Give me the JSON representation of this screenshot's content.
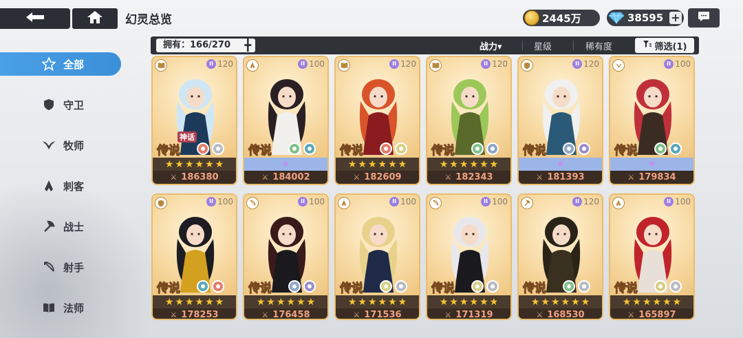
{
  "header": {
    "title": "幻灵总览",
    "gold": "2445万",
    "gems": "38595"
  },
  "sidebar": {
    "items": [
      {
        "label": "全部",
        "icon": "all-star-icon",
        "active": true
      },
      {
        "label": "守卫",
        "icon": "shield-icon",
        "active": false
      },
      {
        "label": "牧师",
        "icon": "wings-icon",
        "active": false
      },
      {
        "label": "刺客",
        "icon": "assassin-icon",
        "active": false
      },
      {
        "label": "战士",
        "icon": "axe-icon",
        "active": false
      },
      {
        "label": "射手",
        "icon": "bow-icon",
        "active": false
      },
      {
        "label": "法师",
        "icon": "book-icon",
        "active": false
      }
    ]
  },
  "filter": {
    "owned": "拥有：166/270",
    "sort_power": "战力▾",
    "sort_stars": "星级",
    "sort_rarity": "稀有度",
    "filter_label": "筛选(1)"
  },
  "cards": [
    {
      "level": "120",
      "rarity": "传说",
      "tag": "神话",
      "power": "186380",
      "class": "book-icon",
      "e1": "fire",
      "e2": "wind",
      "row": "stars",
      "hair": "#cfe6f5",
      "outfit": "#1d3a5a"
    },
    {
      "level": "100",
      "rarity": "传说",
      "tag": "",
      "power": "184002",
      "class": "assassin-icon",
      "e1": "nature",
      "e2": "water",
      "row": "awakening",
      "hair": "#2a2024",
      "outfit": "#f2f0ec"
    },
    {
      "level": "120",
      "rarity": "传说",
      "tag": "",
      "power": "182609",
      "class": "book-icon",
      "e1": "fire",
      "e2": "light",
      "row": "stars",
      "hair": "#d9542a",
      "outfit": "#8a1c20"
    },
    {
      "level": "120",
      "rarity": "传说",
      "tag": "",
      "power": "182343",
      "class": "book-icon",
      "e1": "nature",
      "e2": "star",
      "row": "stars",
      "hair": "#9cc85a",
      "outfit": "#5a6a2a"
    },
    {
      "level": "120",
      "rarity": "传说",
      "tag": "",
      "power": "181393",
      "class": "shield-icon",
      "e1": "star",
      "e2": "void",
      "row": "awakening",
      "hair": "#f0f0f0",
      "outfit": "#2a5a78"
    },
    {
      "level": "100",
      "rarity": "传说",
      "tag": "",
      "power": "179834",
      "class": "wings-icon",
      "e1": "nature",
      "e2": "water",
      "row": "awakening",
      "hair": "#c0303a",
      "outfit": "#3a2c22"
    },
    {
      "level": "100",
      "rarity": "传说",
      "tag": "",
      "power": "178253",
      "class": "shield-icon",
      "e1": "water",
      "e2": "fire",
      "row": "stars",
      "hair": "#1c1c22",
      "outfit": "#d4a020"
    },
    {
      "level": "100",
      "rarity": "传说",
      "tag": "",
      "power": "176458",
      "class": "bow-icon",
      "e1": "star",
      "e2": "void",
      "row": "stars",
      "hair": "#3a1a1a",
      "outfit": "#1a1a1e"
    },
    {
      "level": "100",
      "rarity": "传说",
      "tag": "",
      "power": "171536",
      "class": "assassin-icon",
      "e1": "light",
      "e2": "wind",
      "row": "stars",
      "hair": "#e8d18a",
      "outfit": "#1e2a48"
    },
    {
      "level": "100",
      "rarity": "传说",
      "tag": "",
      "power": "171319",
      "class": "bow-icon",
      "e1": "light",
      "e2": "wind",
      "row": "stars",
      "hair": "#e8e8ec",
      "outfit": "#1a1a1e"
    },
    {
      "level": "120",
      "rarity": "传说",
      "tag": "",
      "power": "168530",
      "class": "axe-icon",
      "e1": "nature",
      "e2": "wind",
      "row": "stars",
      "hair": "#2a2418",
      "outfit": "#3a3020"
    },
    {
      "level": "100",
      "rarity": "传说",
      "tag": "",
      "power": "165897",
      "class": "assassin-icon",
      "e1": "light",
      "e2": "wind",
      "row": "stars",
      "hair": "#c0242a",
      "outfit": "#e8e0d8"
    }
  ],
  "colors": {
    "accent_blue": "#3b8fd8",
    "dark_panel": "#2f3237",
    "card_gold": "#f7d9a2",
    "star_gold": "#f5c531",
    "power_text": "#f0a080"
  }
}
